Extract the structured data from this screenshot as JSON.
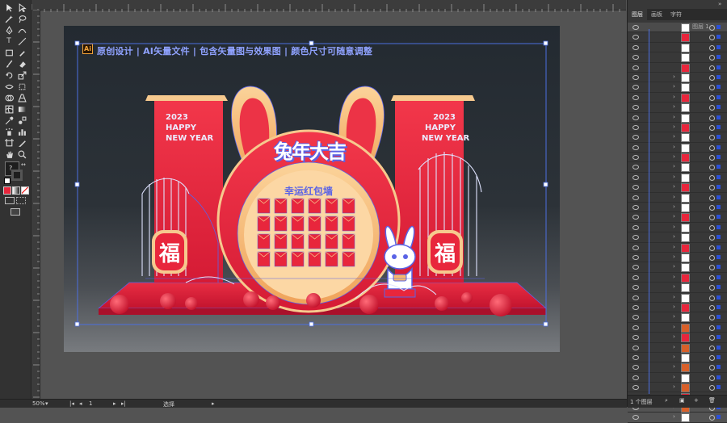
{
  "app": {
    "name": "Adobe Illustrator"
  },
  "artboard": {
    "logo_text": "Ai",
    "header": "原创设计 | AI矢量文件 | 包含矢量图与效果图 | 颜色尺寸可随意调整"
  },
  "design": {
    "title": "兔年大吉",
    "banner_left": [
      "2023",
      "HAPPY",
      "NEW YEAR"
    ],
    "banner_right": [
      "2023",
      "HAPPY",
      "NEW YEAR"
    ],
    "wall_title": "幸运红包墙",
    "fu_left": "福",
    "fu_right": "福",
    "envelope_rows": 4,
    "envelope_cols": 6,
    "colors": {
      "red": "#e8263c",
      "orange": "#f5b86e",
      "blue": "#5a63e6",
      "bg": "#232a31"
    }
  },
  "status_bar": {
    "zoom": "50%",
    "page": "1",
    "mode": "选择"
  },
  "panel": {
    "tabs": [
      "图层",
      "画板",
      "字符"
    ],
    "active_tab": "图层",
    "top_layer": "图层 1",
    "layer_count_label": "1 个图层"
  }
}
